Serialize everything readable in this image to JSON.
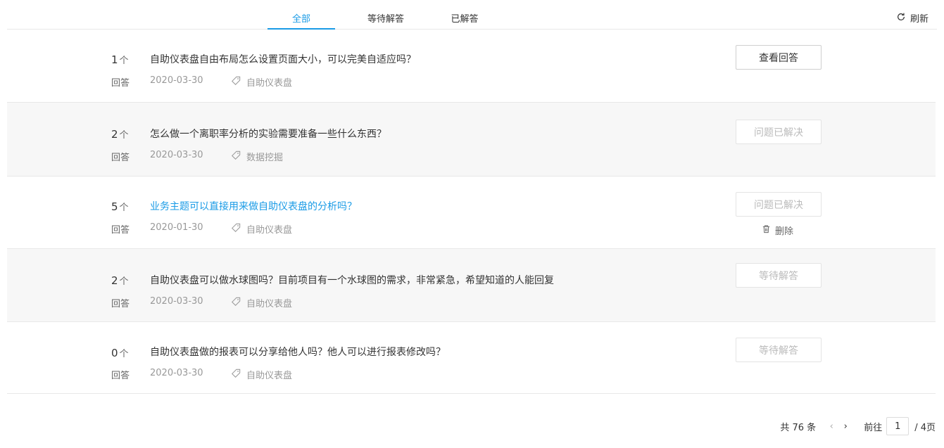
{
  "tabs": [
    {
      "label": "全部"
    },
    {
      "label": "等待解答"
    },
    {
      "label": "已解答"
    }
  ],
  "refresh_label": "刷新",
  "count_unit": "个",
  "count_sub": "回答",
  "questions": [
    {
      "count": "1",
      "title": "自助仪表盘自由布局怎么设置页面大小，可以完美自适应吗？",
      "date": "2020-03-30",
      "tag": "自助仪表盘",
      "status": "查看回答"
    },
    {
      "count": "2",
      "title": "怎么做一个离职率分析的实验需要准备一些什么东西？",
      "date": "2020-03-30",
      "tag": "数据挖掘",
      "status": "问题已解决"
    },
    {
      "count": "5",
      "title": "业务主题可以直接用来做自助仪表盘的分析吗？",
      "date": "2020-01-30",
      "tag": "自助仪表盘",
      "status": "问题已解决",
      "action": "删除"
    },
    {
      "count": "2",
      "title": "自助仪表盘可以做水球图吗？目前项目有一个水球图的需求，非常紧急，希望知道的人能回复",
      "date": "2020-03-30",
      "tag": "自助仪表盘",
      "status": "等待解答"
    },
    {
      "count": "0",
      "title": "自助仪表盘做的报表可以分享给他人吗？他人可以进行报表修改吗？",
      "date": "2020-03-30",
      "tag": "自助仪表盘",
      "status": "等待解答"
    }
  ],
  "pagination": {
    "total_label": "共 76 条",
    "goto_label": "前往",
    "page_value": "1",
    "total_pages_label": "/ 4页"
  },
  "colors": {
    "accent": "#1a9be6",
    "row_alt": "#f7f7f7"
  }
}
